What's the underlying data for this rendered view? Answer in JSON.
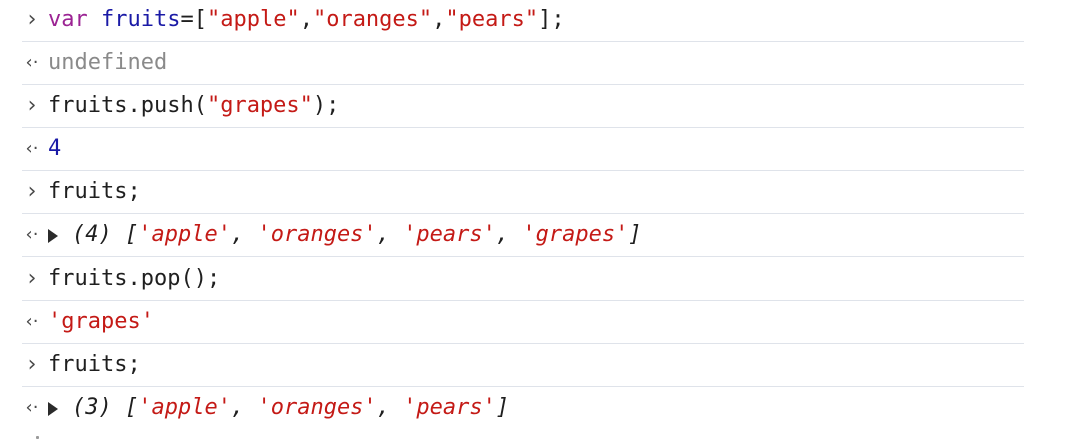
{
  "console": {
    "rows": [
      {
        "kind": "input",
        "glyph": "›",
        "tokens": [
          {
            "t": "var",
            "c": "kw"
          },
          {
            "t": " ",
            "c": "plain"
          },
          {
            "t": "fruits",
            "c": "ident"
          },
          {
            "t": "=",
            "c": "punct"
          },
          {
            "t": "[",
            "c": "punct"
          },
          {
            "t": "\"apple\"",
            "c": "str"
          },
          {
            "t": ",",
            "c": "punct"
          },
          {
            "t": "\"oranges\"",
            "c": "str"
          },
          {
            "t": ",",
            "c": "punct"
          },
          {
            "t": "\"pears\"",
            "c": "str"
          },
          {
            "t": "];",
            "c": "punct"
          }
        ]
      },
      {
        "kind": "result",
        "glyph": "‹·",
        "tokens": [
          {
            "t": "undefined",
            "c": "muted"
          }
        ]
      },
      {
        "kind": "input",
        "glyph": "›",
        "tokens": [
          {
            "t": "fruits.push(",
            "c": "plain"
          },
          {
            "t": "\"grapes\"",
            "c": "str"
          },
          {
            "t": ");",
            "c": "plain"
          }
        ]
      },
      {
        "kind": "result",
        "glyph": "‹·",
        "tokens": [
          {
            "t": "4",
            "c": "num"
          }
        ]
      },
      {
        "kind": "input",
        "glyph": "›",
        "tokens": [
          {
            "t": "fruits;",
            "c": "plain"
          }
        ]
      },
      {
        "kind": "result-array",
        "glyph": "‹·",
        "count": "(4)",
        "items": [
          "'apple'",
          "'oranges'",
          "'pears'",
          "'grapes'"
        ]
      },
      {
        "kind": "input",
        "glyph": "›",
        "tokens": [
          {
            "t": "fruits.pop();",
            "c": "plain"
          }
        ]
      },
      {
        "kind": "result",
        "glyph": "‹·",
        "tokens": [
          {
            "t": "'grapes'",
            "c": "str"
          }
        ]
      },
      {
        "kind": "input",
        "glyph": "›",
        "tokens": [
          {
            "t": "fruits;",
            "c": "plain"
          }
        ]
      },
      {
        "kind": "result-array",
        "glyph": "‹·",
        "count": "(3)",
        "items": [
          "'apple'",
          "'oranges'",
          "'pears'"
        ]
      }
    ]
  },
  "colors": {
    "keyword": "#9b2393",
    "identifier": "#1a1aa6",
    "string": "#c41a16",
    "muted": "#8a8a8a",
    "separator": "#dfe3ea"
  },
  "icons": {
    "input": "prompt-chevron-icon",
    "result": "result-arrow-icon",
    "expand": "expand-triangle-icon"
  }
}
